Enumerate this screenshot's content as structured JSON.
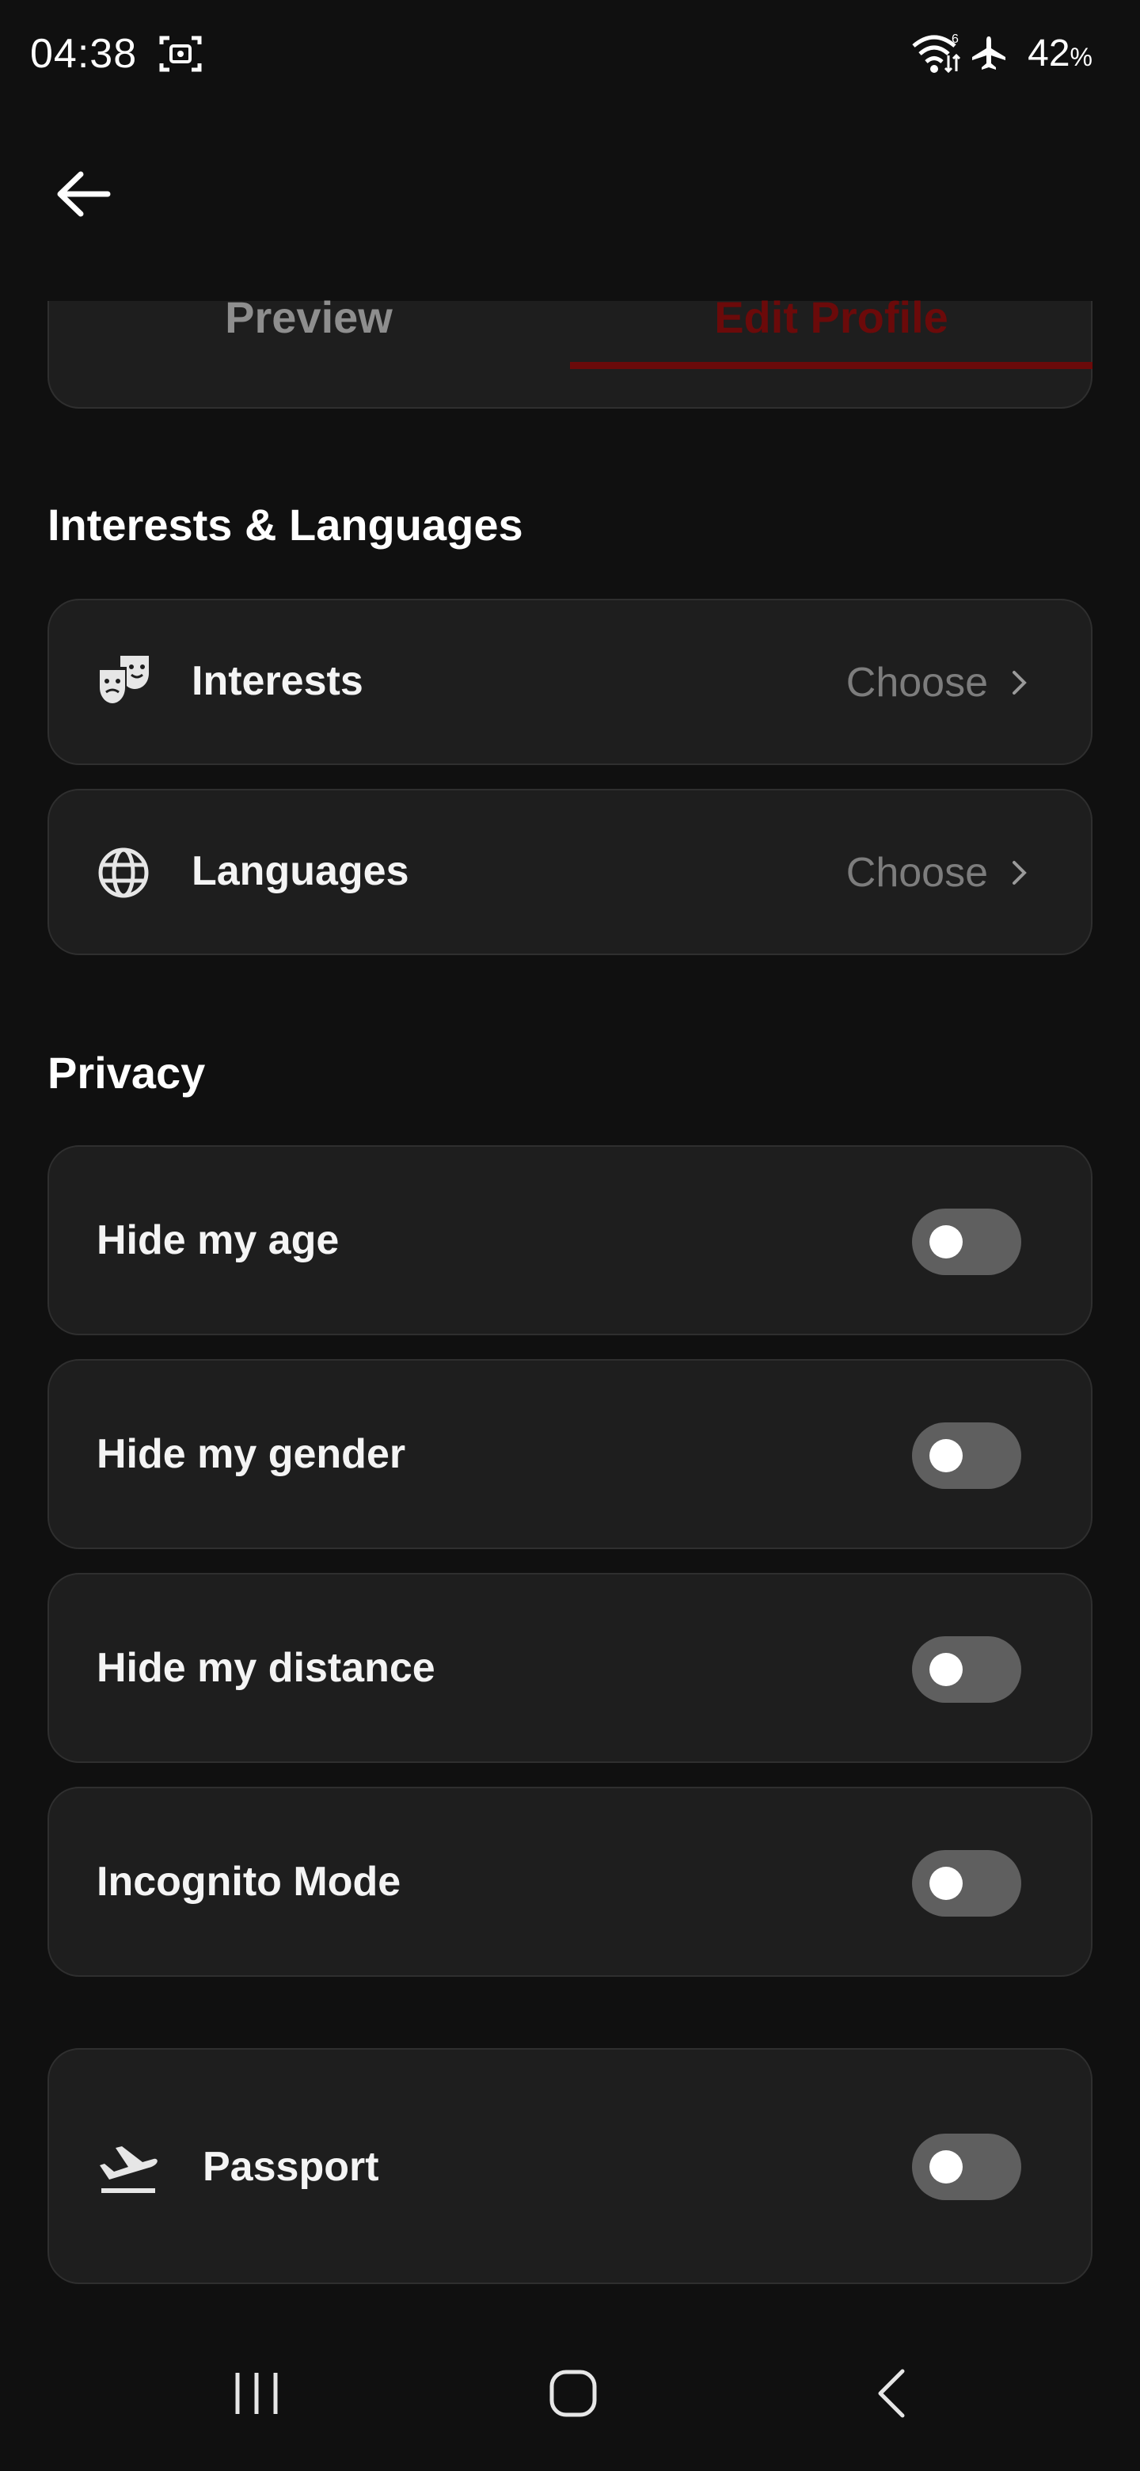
{
  "status_bar": {
    "time": "04:38",
    "battery": "42",
    "battery_unit": "%",
    "icons": [
      "screenshot-icon",
      "wifi-icon",
      "airplane-mode-icon"
    ]
  },
  "tabs": [
    {
      "label": "Preview",
      "active": false
    },
    {
      "label": "Edit Profile",
      "active": true
    }
  ],
  "interests_section": {
    "title": "Interests & Languages",
    "items": [
      {
        "label": "Interests",
        "value": "Choose",
        "icon": "theater-masks-icon"
      },
      {
        "label": "Languages",
        "value": "Choose",
        "icon": "globe-icon"
      }
    ]
  },
  "privacy_section": {
    "title": "Privacy",
    "items": [
      {
        "label": "Hide my age",
        "enabled": false
      },
      {
        "label": "Hide my gender",
        "enabled": false
      },
      {
        "label": "Hide my distance",
        "enabled": false
      },
      {
        "label": "Incognito Mode",
        "enabled": false
      }
    ]
  },
  "passport": {
    "label": "Passport",
    "enabled": false,
    "icon": "flight-takeoff-icon"
  },
  "colors": {
    "background": "#101010",
    "card": "#1e1e1e",
    "accent": "#6b0a0a",
    "toggle_off": "#5f5f5f"
  }
}
